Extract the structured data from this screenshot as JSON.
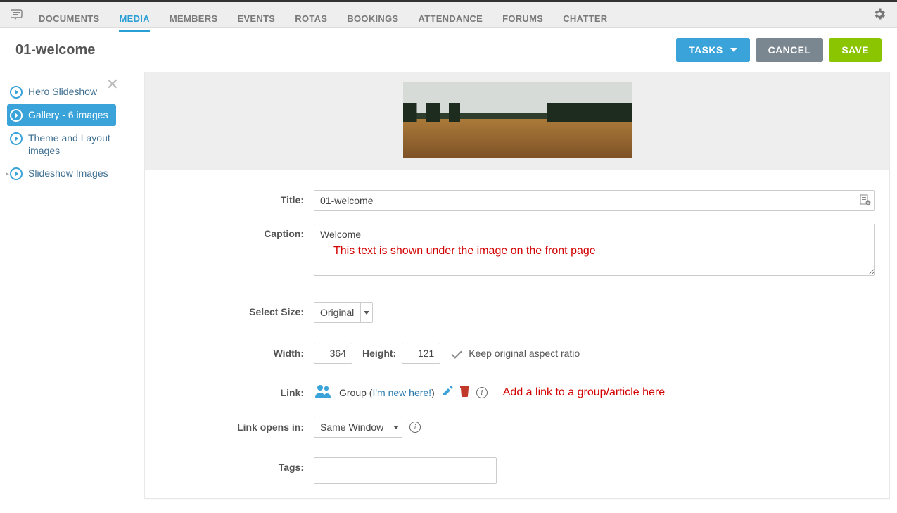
{
  "nav": {
    "items": [
      "DOCUMENTS",
      "MEDIA",
      "MEMBERS",
      "EVENTS",
      "ROTAS",
      "BOOKINGS",
      "ATTENDANCE",
      "FORUMS",
      "CHATTER"
    ],
    "active": "MEDIA"
  },
  "page": {
    "title": "01-welcome"
  },
  "actions": {
    "tasks": "TASKS",
    "cancel": "CANCEL",
    "save": "SAVE"
  },
  "sidebar": {
    "items": [
      {
        "label": "Hero Slideshow"
      },
      {
        "label": "Gallery - 6 images"
      },
      {
        "label": "Theme and Layout images"
      },
      {
        "label": "Slideshow Images"
      }
    ],
    "activeIndex": 1
  },
  "form": {
    "labels": {
      "title": "Title:",
      "caption": "Caption:",
      "selectSize": "Select Size:",
      "width": "Width:",
      "height": "Height:",
      "aspect": "Keep original aspect ratio",
      "link": "Link:",
      "linkOpens": "Link opens in:",
      "tags": "Tags:"
    },
    "title": "01-welcome",
    "caption": "Welcome",
    "captionAnnot": "This text is shown under the image on the front page",
    "selectSize": "Original",
    "width": "364",
    "height": "121",
    "link": {
      "prefix": "Group (",
      "text": "I'm new here!",
      "suffix": ")"
    },
    "linkAnnot": "Add a link to a group/article here",
    "linkOpens": "Same Window",
    "tags": ""
  }
}
